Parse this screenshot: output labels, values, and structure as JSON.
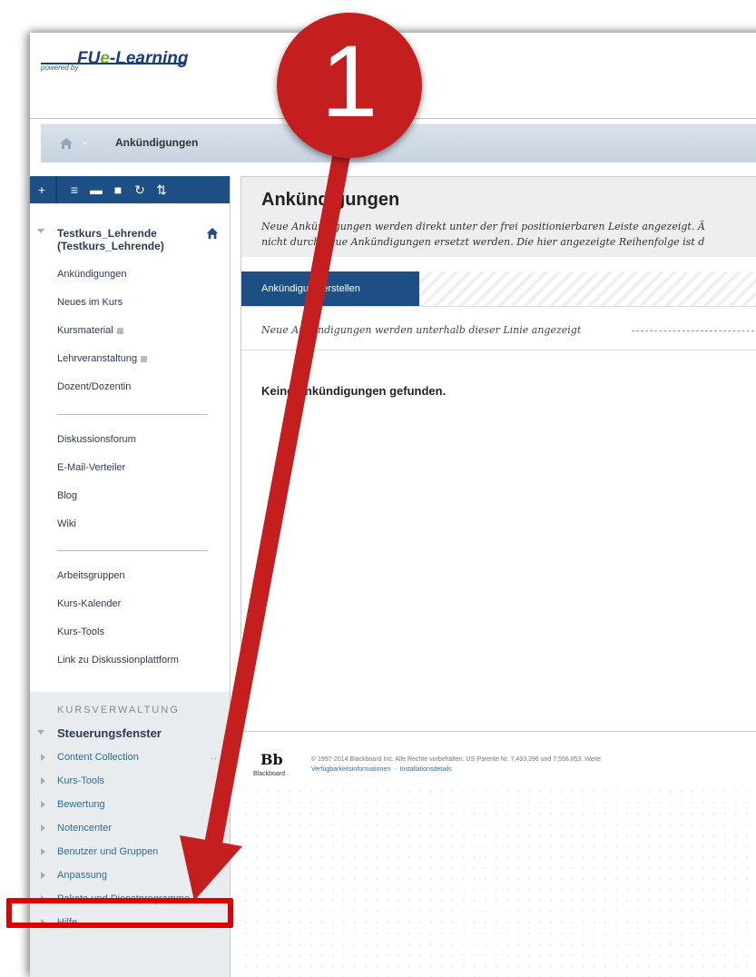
{
  "header": {
    "powered_by": "powered by",
    "brand_fu": "FU",
    "brand_e": "e",
    "brand_rest": "-Learning"
  },
  "breadcrumb": {
    "current": "Ankündigungen"
  },
  "sidebar": {
    "course_title_line1": "Testkurs_Lehrende",
    "course_title_line2": "(Testkurs_Lehrende)",
    "items_group1": [
      "Ankündigungen",
      "Neues im Kurs",
      "Kursmaterial",
      "Lehrveranstaltung",
      "Dozent/Dozentin"
    ],
    "items_group2": [
      "Diskussionsforum",
      "E-Mail-Verteiler",
      "Blog",
      "Wiki"
    ],
    "items_group3": [
      "Arbeitsgruppen",
      "Kurs-Kalender",
      "Kurs-Tools",
      "Link zu Diskussionplattform"
    ]
  },
  "admin": {
    "heading": "KURSVERWALTUNG",
    "panel_title": "Steuerungsfenster",
    "items": [
      "Content Collection",
      "Kurs-Tools",
      "Bewertung",
      "Notencenter",
      "Benutzer und Gruppen",
      "Anpassung",
      "Pakete und Dienstprogramme",
      "Hilfe"
    ]
  },
  "content": {
    "title": "Ankündigungen",
    "desc_line1": "Neue Ankündigungen werden direkt unter der frei positionierbaren Leiste angezeigt. Ä",
    "desc_line2": "nicht durch neue Ankündigungen ersetzt werden. Die hier angezeigte Reihenfolge ist d",
    "create_button": "Ankündigung erstellen",
    "line_text": "Neue Ankündigungen werden unterhalb dieser Linie angezeigt",
    "empty_message": "Keine Ankündigungen gefunden."
  },
  "footer": {
    "bb_logo": "Bb",
    "bb_word": "Blackboard",
    "copyright": "© 1997-2014 Blackboard Inc. Alle Rechte vorbehalten. US-Patente Nr. 7,493,396 und 7,558,853. Weite",
    "link1": "Verfügbarkeitsinformationen",
    "link_sep": "-",
    "link2": "Installationsdetails"
  },
  "annotation": {
    "step_number": "1",
    "highlight_color": "#dd0000",
    "badge_color": "#c41e1e"
  },
  "colors": {
    "toolbar_blue": "#1e4f84",
    "link_blue": "#2f6e9c"
  }
}
